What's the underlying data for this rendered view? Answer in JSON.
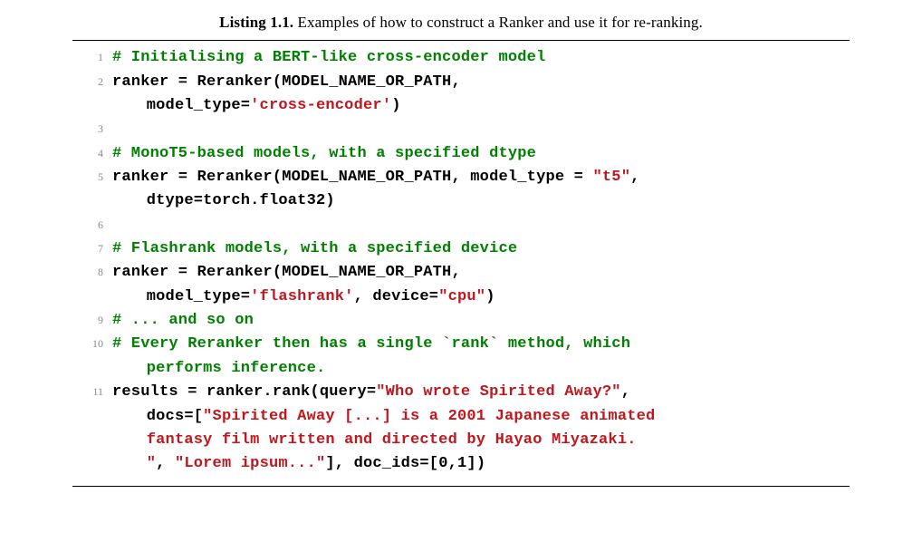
{
  "caption": {
    "label": "Listing 1.1.",
    "text": " Examples of how to construct a Ranker and use it for re-ranking."
  },
  "code": {
    "l1": {
      "n": "1",
      "c1": "# Initialising a BERT-like cross-encoder model"
    },
    "l2": {
      "n": "2",
      "t1": "ranker = Reranker(MODEL_NAME_OR_PATH,"
    },
    "l2b": {
      "t1": "model_type=",
      "s1": "'cross-encoder'",
      "t2": ")"
    },
    "l3": {
      "n": "3"
    },
    "l4": {
      "n": "4",
      "c1": "# MonoT5-based models, with a specified dtype"
    },
    "l5": {
      "n": "5",
      "t1": "ranker = Reranker(MODEL_NAME_OR_PATH, model_type = ",
      "s1": "\"t5\"",
      "t2": ","
    },
    "l5b": {
      "t1": "dtype=torch.float32)"
    },
    "l6": {
      "n": "6"
    },
    "l7": {
      "n": "7",
      "c1": "# Flashrank models, with a specified device"
    },
    "l8": {
      "n": "8",
      "t1": "ranker = Reranker(MODEL_NAME_OR_PATH,"
    },
    "l8b": {
      "t1": "model_type=",
      "s1": "'flashrank'",
      "t2": ", device=",
      "s2": "\"cpu\"",
      "t3": ")"
    },
    "l9": {
      "n": "9",
      "c1": "# ... and so on"
    },
    "l10": {
      "n": "10",
      "c1": "# Every Reranker then has a single `rank` method, which"
    },
    "l10b": {
      "c1": "performs inference."
    },
    "l11": {
      "n": "11",
      "t1": "results = ranker.rank(query=",
      "s1": "\"Who wrote Spirited Away?\"",
      "t2": ","
    },
    "l11b": {
      "t1": "docs=[",
      "s1": "\"Spirited Away [...] is a 2001 Japanese animated"
    },
    "l11c": {
      "s1": "fantasy film written and directed by Hayao Miyazaki."
    },
    "l11d": {
      "s1": "\"",
      "t1": ", ",
      "s2": "\"Lorem ipsum...\"",
      "t2": "], doc_ids=[0,1])"
    }
  }
}
